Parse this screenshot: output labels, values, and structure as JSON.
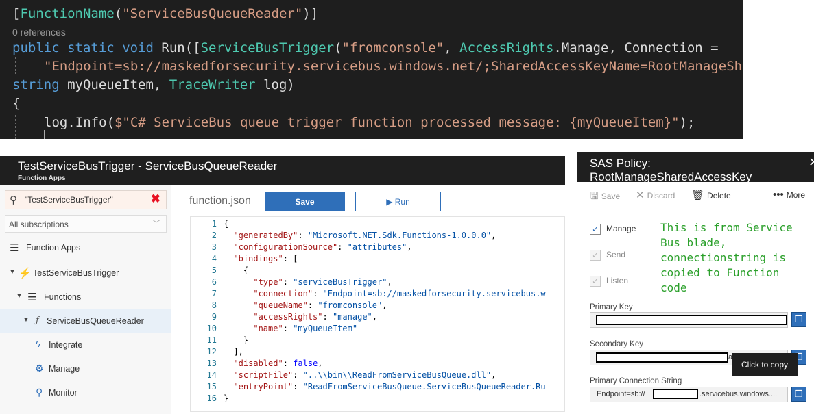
{
  "code_editor": {
    "attr_open": "[",
    "attr_name": "FunctionName",
    "attr_arg": "\"ServiceBusQueueReader\"",
    "attr_close": ")]",
    "references": "0 references",
    "kw_public": "public",
    "kw_static": "static",
    "kw_void": "void",
    "run_open": " Run([",
    "trigger_type": "ServiceBusTrigger",
    "trigger_arg": "\"fromconsole\"",
    "access_type": "AccessRights",
    "access_rest": ".Manage, Connection =",
    "connection_string": "\"Endpoint=sb://maskedforsecurity.servicebus.windows.net/;SharedAccessKeyName=RootManageSh",
    "kw_string": "string",
    "param_rest": " myQueueItem, ",
    "trace_type": "TraceWriter",
    "log_param": " log)",
    "brace_open": "{",
    "log_call": "log.Info(",
    "log_message": "$\"C# ServiceBus queue trigger function processed message: {myQueueItem}\"",
    "log_close": ");"
  },
  "function_app": {
    "title": "TestServiceBusTrigger - ServiceBusQueueReader",
    "subtitle": "Function Apps"
  },
  "sidebar": {
    "search_value": "\"TestServiceBusTrigger\"",
    "subscriptions": "All subscriptions",
    "items": [
      {
        "label": "Function Apps"
      },
      {
        "label": "TestServiceBusTrigger"
      },
      {
        "label": "Functions"
      },
      {
        "label": "ServiceBusQueueReader"
      },
      {
        "label": "Integrate"
      },
      {
        "label": "Manage"
      },
      {
        "label": "Monitor"
      }
    ]
  },
  "editor": {
    "file_name": "function.json",
    "save_label": "Save",
    "run_label": "Run",
    "json_lines": [
      "{",
      "  \"generatedBy\": \"Microsoft.NET.Sdk.Functions-1.0.0.0\",",
      "  \"configurationSource\": \"attributes\",",
      "  \"bindings\": [",
      "    {",
      "      \"type\": \"serviceBusTrigger\",",
      "      \"connection\": \"Endpoint=sb://maskedforsecurity.servicebus.w",
      "      \"queueName\": \"fromconsole\",",
      "      \"accessRights\": \"manage\",",
      "      \"name\": \"myQueueItem\"",
      "    }",
      "  ],",
      "  \"disabled\": false,",
      "  \"scriptFile\": \"..\\\\bin\\\\ReadFromServiceBusQueue.dll\",",
      "  \"entryPoint\": \"ReadFromServiceBusQueue.ServiceBusQueueReader.Ru",
      "}"
    ]
  },
  "sas_policy": {
    "title": "SAS Policy: RootManageSharedAccessKey",
    "toolbar": {
      "save": "Save",
      "discard": "Discard",
      "delete": "Delete",
      "more": "More"
    },
    "claims": [
      {
        "label": "Manage",
        "checked": true
      },
      {
        "label": "Send",
        "checked": true
      },
      {
        "label": "Listen",
        "checked": true
      }
    ],
    "note": "This is from Service Bus blade, connectionstring is copied to Function code",
    "primary_key_label": "Primary Key",
    "secondary_key_label": "Secondary Key",
    "secondary_key_suffix": "a",
    "primary_conn_label": "Primary Connection String",
    "primary_conn_prefix": "Endpoint=sb://",
    "primary_conn_suffix": ".servicebus.windows....",
    "tooltip": "Click to copy"
  }
}
